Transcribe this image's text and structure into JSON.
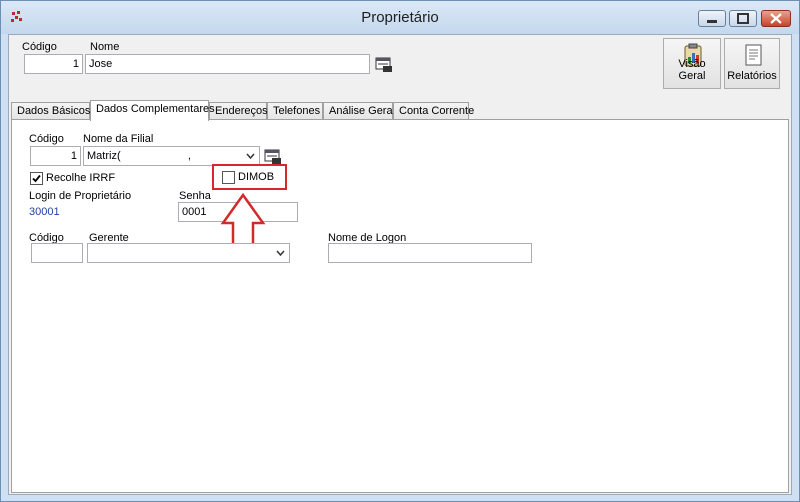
{
  "window": {
    "title": "Proprietário"
  },
  "header": {
    "codigo_label": "Código",
    "codigo_value": "1",
    "nome_label": "Nome",
    "nome_value": "Jose",
    "visao_geral_label": "Visão Geral",
    "relatorios_label": "Relatórios"
  },
  "tabs": [
    {
      "label": "Dados Básicos"
    },
    {
      "label": "Dados Complementares",
      "active": true
    },
    {
      "label": "Endereços"
    },
    {
      "label": "Telefones"
    },
    {
      "label": "Análise Geral"
    },
    {
      "label": "Conta Corrente"
    }
  ],
  "panel": {
    "codigo_label": "Código",
    "codigo_value": "1",
    "filial_label": "Nome da Filial",
    "filial_value": "Matriz(                      ,",
    "recolhe_irrf_label": "Recolhe IRRF",
    "recolhe_irrf_checked": true,
    "dimob_label": "DIMOB",
    "dimob_checked": false,
    "login_label": "Login de Proprietário",
    "login_value": "30001",
    "senha_label": "Senha",
    "senha_value": "0001",
    "gerente_codigo_label": "Código",
    "gerente_codigo_value": "",
    "gerente_label": "Gerente",
    "gerente_value": "",
    "logon_label": "Nome de Logon",
    "logon_value": ""
  },
  "annotation": {
    "color": "#d22a2a"
  }
}
